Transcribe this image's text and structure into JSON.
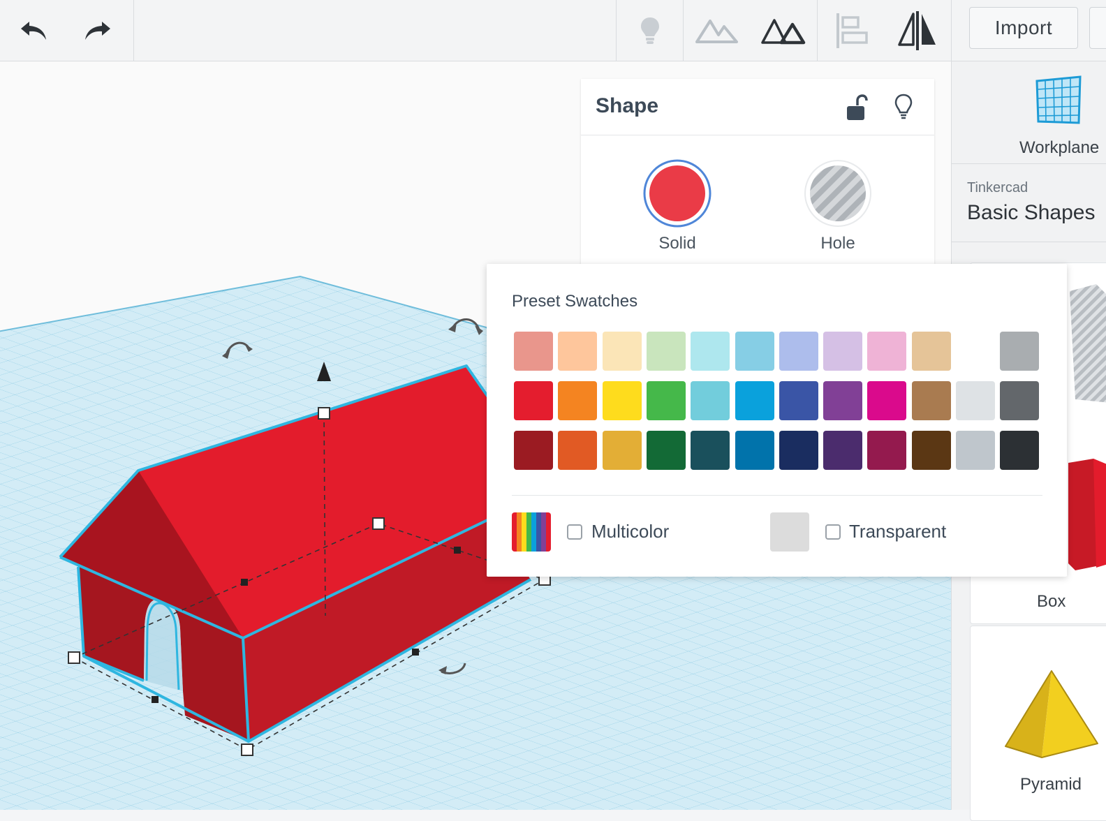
{
  "toolbar": {
    "undo": "undo-icon",
    "redo": "redo-icon",
    "import_label": "Import"
  },
  "inspector": {
    "title": "Shape",
    "solid_label": "Solid",
    "hole_label": "Hole",
    "solid_color": "#ea3b47"
  },
  "color_popup": {
    "title": "Preset Swatches",
    "swatch_rows": [
      [
        "#e9968c",
        "#fec69c",
        "#fbe5b7",
        "#c9e5bd",
        "#aee7ee",
        "#86cee5",
        "#adbdec",
        "#d5c0e5",
        "#efb3d6",
        "#e5c498",
        "",
        "#a9adb0"
      ],
      [
        "#e41d2e",
        "#f48421",
        "#fedc1d",
        "#45b84a",
        "#72cddc",
        "#0aa1dc",
        "#3a55a6",
        "#814096",
        "#da0a8c",
        "#a97b50",
        "#dee2e5",
        "#63676b"
      ],
      [
        "#9b1b22",
        "#e15a24",
        "#e3ae36",
        "#136a36",
        "#1a505c",
        "#0173ab",
        "#1a2d60",
        "#4b2c6d",
        "#941a4e",
        "#5b3714",
        "#bfc6cc",
        "#2c3034"
      ]
    ],
    "multicolor_label": "Multicolor",
    "transparent_label": "Transparent"
  },
  "library": {
    "workplane_label": "Workplane",
    "source_label": "Tinkercad",
    "category_label": "Basic Shapes",
    "box_label": "Box",
    "pyramid_label": "Pyramid"
  }
}
